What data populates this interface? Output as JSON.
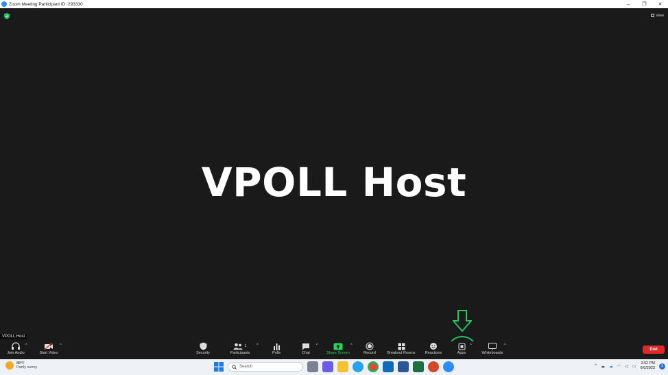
{
  "window": {
    "title": "Zoom Meeting Participant ID: 293330",
    "controls": [
      "–",
      "❐",
      "✕"
    ]
  },
  "stage": {
    "view_label": "View",
    "display_name": "VPOLL Host",
    "name_tag": "VPOLL Host"
  },
  "toolbar": {
    "join_audio": "Join Audio",
    "start_video": "Start Video",
    "security": "Security",
    "participants": "Participants",
    "participants_count": "1",
    "polls": "Polls",
    "chat": "Chat",
    "share_screen": "Share Screen",
    "record": "Record",
    "breakout_rooms": "Breakout Rooms",
    "reactions": "Reactions",
    "apps": "Apps",
    "whiteboards": "Whiteboards",
    "end": "End"
  },
  "taskbar": {
    "weather_temp": "88°F",
    "weather_desc": "Partly sunny",
    "search_placeholder": "Search",
    "time": "3:52 PM",
    "date": "6/6/2023",
    "notifications": "3"
  },
  "colors": {
    "accent_green": "#22c55e",
    "end_red": "#e02828",
    "share_green": "#23d959",
    "zoom_blue": "#2d8cff"
  }
}
